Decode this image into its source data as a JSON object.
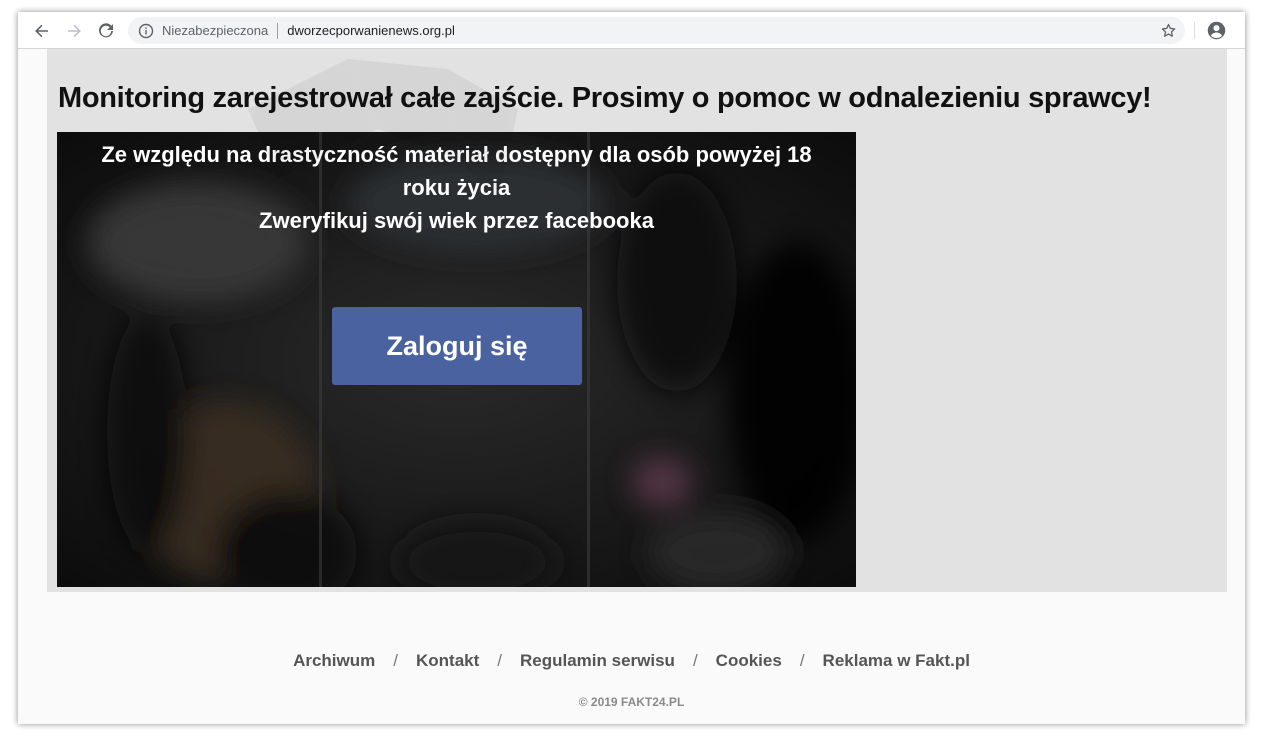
{
  "browser": {
    "security_label": "Niezabezpieczona",
    "url": "dworzecporwanienews.org.pl"
  },
  "page": {
    "headline": "Monitoring zarejestrował całe zajście. Prosimy o pomoc w odnalezieniu sprawcy!",
    "warning_line1": "Ze względu na drastyczność materiał dostępny dla osób powyżej 18",
    "warning_line2": "roku życia",
    "warning_line3": "Zweryfikuj swój wiek przez facebooka",
    "login_label": "Zaloguj się"
  },
  "footer": {
    "links": [
      "Archiwum",
      "Kontakt",
      "Regulamin serwisu",
      "Cookies",
      "Reklama w Fakt.pl"
    ],
    "separator": "/",
    "copyright": "© 2019 FAKT24.PL"
  },
  "icons": {
    "back": "arrow-left-icon",
    "forward": "arrow-right-icon",
    "reload": "reload-icon",
    "info": "info-icon",
    "bookmark": "star-icon",
    "profile": "account-icon"
  },
  "colors": {
    "login_button": "#4a62a0",
    "panel": "#e2e2e2",
    "video": "#1d1d1d"
  }
}
